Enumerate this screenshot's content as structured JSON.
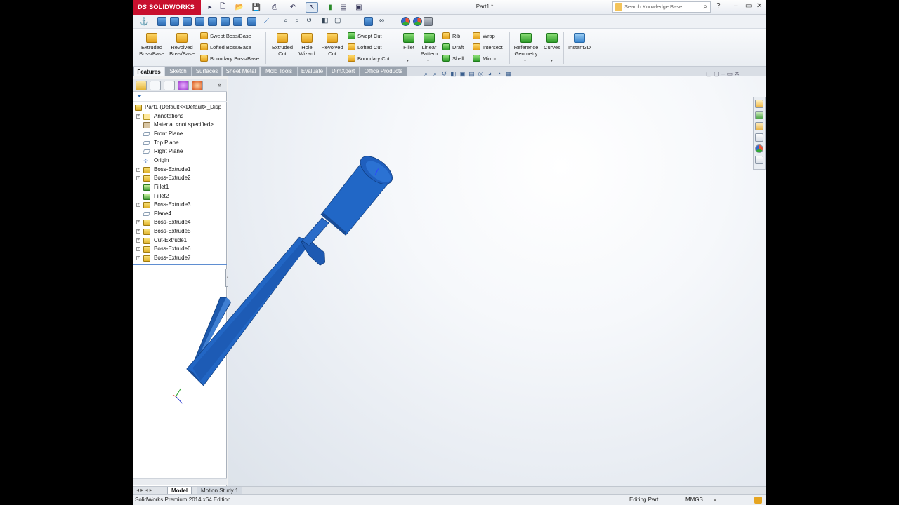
{
  "app": {
    "logo_text": "SOLIDWORKS",
    "logo_prefix": "DS",
    "doc_title": "Part1 *",
    "search_placeholder": "Search Knowledge Base",
    "window_controls": [
      "?",
      "–",
      "▭",
      "✕"
    ]
  },
  "ribbon": {
    "big_buttons": [
      {
        "label1": "Extruded",
        "label2": "Boss/Base",
        "icon": "extrude-icon"
      },
      {
        "label1": "Revolved",
        "label2": "Boss/Base",
        "icon": "revolve-icon"
      },
      {
        "label1": "Extruded",
        "label2": "Cut",
        "icon": "extruded-cut-icon"
      },
      {
        "label1": "Hole",
        "label2": "Wizard",
        "icon": "hole-wizard-icon"
      },
      {
        "label1": "Revolved",
        "label2": "Cut",
        "icon": "revolved-cut-icon"
      },
      {
        "label1": "Fillet",
        "label2": "",
        "icon": "fillet-icon"
      },
      {
        "label1": "Linear",
        "label2": "Pattern",
        "icon": "linear-pattern-icon"
      },
      {
        "label1": "Reference",
        "label2": "Geometry",
        "icon": "reference-geometry-icon"
      },
      {
        "label1": "Curves",
        "label2": "",
        "icon": "curves-icon"
      },
      {
        "label1": "Instant3D",
        "label2": "",
        "icon": "instant3d-icon"
      }
    ],
    "small_buttons": {
      "swept_boss": "Swept Boss/Base",
      "lofted_boss": "Lofted Boss/Base",
      "boundary_boss": "Boundary Boss/Base",
      "swept_cut": "Swept Cut",
      "lofted_cut": "Lofted Cut",
      "boundary_cut": "Boundary Cut",
      "rib": "Rib",
      "draft": "Draft",
      "shell": "Shell",
      "wrap": "Wrap",
      "intersect": "Intersect",
      "mirror": "Mirror"
    }
  },
  "tabs": [
    "Features",
    "Sketch",
    "Surfaces",
    "Sheet Metal",
    "Mold Tools",
    "Evaluate",
    "DimXpert",
    "Office Products"
  ],
  "active_tab": "Features",
  "feature_tree": [
    {
      "label": "Part1  (Default<<Default>_Disp",
      "icon": "part",
      "expand": false
    },
    {
      "label": "Annotations",
      "icon": "ann",
      "expand": true
    },
    {
      "label": "Material <not specified>",
      "icon": "mat",
      "expand": false
    },
    {
      "label": "Front Plane",
      "icon": "plane",
      "expand": false
    },
    {
      "label": "Top Plane",
      "icon": "plane",
      "expand": false
    },
    {
      "label": "Right Plane",
      "icon": "plane",
      "expand": false
    },
    {
      "label": "Origin",
      "icon": "org",
      "expand": false
    },
    {
      "label": "Boss-Extrude1",
      "icon": "feat",
      "expand": true
    },
    {
      "label": "Boss-Extrude2",
      "icon": "feat",
      "expand": true
    },
    {
      "label": "Fillet1",
      "icon": "fil",
      "expand": false
    },
    {
      "label": "Fillet2",
      "icon": "fil",
      "expand": false
    },
    {
      "label": "Boss-Extrude3",
      "icon": "feat",
      "expand": true
    },
    {
      "label": "Plane4",
      "icon": "plane",
      "expand": false
    },
    {
      "label": "Boss-Extrude4",
      "icon": "feat",
      "expand": true
    },
    {
      "label": "Boss-Extrude5",
      "icon": "feat",
      "expand": true
    },
    {
      "label": "Cut-Extrude1",
      "icon": "feat",
      "expand": true
    },
    {
      "label": "Boss-Extrude6",
      "icon": "feat",
      "expand": true
    },
    {
      "label": "Boss-Extrude7",
      "icon": "feat",
      "expand": true
    }
  ],
  "bottom_tabs": [
    "Model",
    "Motion Study 1"
  ],
  "status": {
    "edition": "SolidWorks Premium 2014 x64 Edition",
    "mode": "Editing Part",
    "units": "MMGS"
  },
  "colors": {
    "model_blue": "#1f5db8",
    "brand_red": "#c8102e"
  }
}
